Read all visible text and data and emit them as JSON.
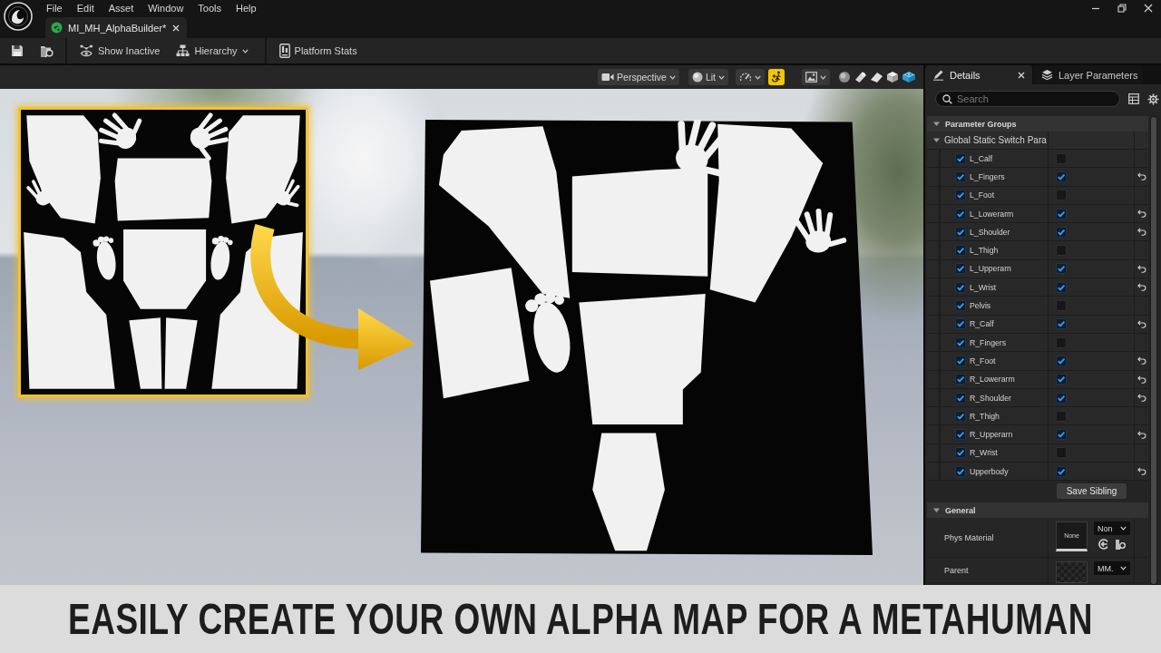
{
  "menu": [
    "File",
    "Edit",
    "Asset",
    "Window",
    "Tools",
    "Help"
  ],
  "document_tab": {
    "title": "MI_MH_AlphaBuilder*"
  },
  "toolbar_groups": [
    [
      {
        "label": "Show Inactive",
        "kind": "button"
      },
      {
        "label": "Hierarchy",
        "kind": "dropdown"
      }
    ],
    [
      {
        "label": "Platform Stats",
        "kind": "button"
      }
    ]
  ],
  "viewport_toolbar": {
    "buttons": [
      {
        "label": "Perspective"
      },
      {
        "label": "Lit"
      }
    ],
    "highlight_toggle": {
      "on": true
    }
  },
  "details_panel": {
    "tabs": [
      {
        "label": "Details",
        "selected": true
      },
      {
        "label": "Layer Parameters",
        "selected": false
      }
    ],
    "search": {
      "placeholder": "Search"
    }
  },
  "parameter_groups": {
    "title": "Parameter Groups",
    "expanded": true,
    "groups": [
      {
        "title": "Global Static Switch Para",
        "expanded": true,
        "parameters": [
          {
            "name": "L_Calf",
            "override": true,
            "value": false,
            "modified": false
          },
          {
            "name": "L_Fingers",
            "override": true,
            "value": true,
            "modified": true
          },
          {
            "name": "L_Foot",
            "override": true,
            "value": false,
            "modified": false
          },
          {
            "name": "L_Lowerarm",
            "override": true,
            "value": true,
            "modified": true
          },
          {
            "name": "L_Shoulder",
            "override": true,
            "value": true,
            "modified": true
          },
          {
            "name": "L_Thigh",
            "override": true,
            "value": false,
            "modified": false
          },
          {
            "name": "L_Upperarn",
            "override": true,
            "value": true,
            "modified": true
          },
          {
            "name": "L_Wrist",
            "override": true,
            "value": true,
            "modified": true
          },
          {
            "name": "Pelvis",
            "override": true,
            "value": false,
            "modified": false
          },
          {
            "name": "R_Calf",
            "override": true,
            "value": true,
            "modified": true
          },
          {
            "name": "R_Fingers",
            "override": true,
            "value": false,
            "modified": false
          },
          {
            "name": "R_Foot",
            "override": true,
            "value": true,
            "modified": true
          },
          {
            "name": "R_Lowerarm",
            "override": true,
            "value": true,
            "modified": true
          },
          {
            "name": "R_Shoulder",
            "override": true,
            "value": true,
            "modified": true
          },
          {
            "name": "R_Thigh",
            "override": true,
            "value": false,
            "modified": false
          },
          {
            "name": "R_Upperarn",
            "override": true,
            "value": true,
            "modified": true
          },
          {
            "name": "R_Wrist",
            "override": true,
            "value": false,
            "modified": false
          },
          {
            "name": "Upperbody",
            "override": true,
            "value": true,
            "modified": true
          }
        ],
        "button": "Save Sibling"
      }
    ]
  },
  "general": {
    "title": "General",
    "expanded": true,
    "properties": [
      {
        "label": "Phys Material",
        "thumbnail": "None",
        "asset": "Non"
      },
      {
        "label": "Parent",
        "asset": "MM."
      }
    ]
  },
  "caption": "EASILY CREATE YOUR OWN ALPHA MAP FOR A METAHUMAN"
}
